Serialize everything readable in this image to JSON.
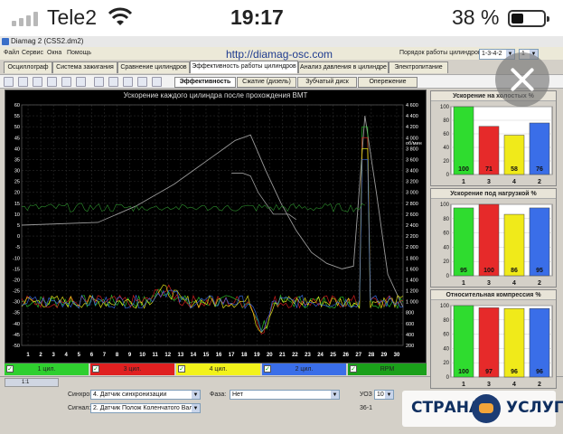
{
  "status": {
    "carrier": "Tele2",
    "time": "19:17",
    "battery_pct": "38 %",
    "battery_level": 0.38
  },
  "window": {
    "title": "Diamag 2 (CSS2.dm2)",
    "menu": [
      "Файл",
      "Сервис",
      "Окна",
      "Помощь"
    ],
    "url": "http://diamag-osc.com",
    "order_label": "Порядок работы цилиндров",
    "order_value": "1-3-4-2",
    "order_small": "1"
  },
  "main_tabs": [
    {
      "label": "Осциллограф",
      "active": false
    },
    {
      "label": "Система зажигания",
      "active": false
    },
    {
      "label": "Сравнение цилиндров",
      "active": false
    },
    {
      "label": "Эффективность работы цилиндров",
      "active": true
    },
    {
      "label": "Анализ давления в цилиндре",
      "active": false
    },
    {
      "label": "Электропитание",
      "active": false
    }
  ],
  "sub_tabs": [
    {
      "label": "Эффективность",
      "active": true
    },
    {
      "label": "Сжатие (дизель)",
      "active": false
    },
    {
      "label": "Зубчатый диск",
      "active": false
    },
    {
      "label": "Опережение",
      "active": false
    }
  ],
  "chart": {
    "title": "Ускорение каждого цилиндра после прохождения ВМТ",
    "left_ticks": [
      "60",
      "55",
      "50",
      "45",
      "40",
      "35",
      "30",
      "25",
      "20",
      "15",
      "10",
      "5",
      "0",
      "-5",
      "-10",
      "-15",
      "-20",
      "-25",
      "-30",
      "-35",
      "-40",
      "-45",
      "-50"
    ],
    "right_ticks": [
      "4 600",
      "4 400",
      "4 200",
      "4 000",
      "3 800",
      "3 600",
      "3 400",
      "3 200",
      "3 000",
      "2 800",
      "2 600",
      "2 400",
      "2 200",
      "2 000",
      "1 800",
      "1 600",
      "1 400",
      "1 200",
      "1 000",
      "800",
      "600",
      "400",
      "200"
    ],
    "x_ticks": [
      "1",
      "2",
      "3",
      "4",
      "5",
      "6",
      "7",
      "8",
      "9",
      "10",
      "11",
      "12",
      "13",
      "14",
      "15",
      "16",
      "17",
      "18",
      "19",
      "20",
      "21",
      "22",
      "23",
      "24",
      "25",
      "26",
      "27",
      "28",
      "29",
      "30"
    ],
    "right_unit": "об/мин"
  },
  "channels": [
    {
      "label": "1 цил.",
      "color": "#2fcf2f"
    },
    {
      "label": "3 цил.",
      "color": "#e02020"
    },
    {
      "label": "4 цил.",
      "color": "#f2f21a"
    },
    {
      "label": "2 цил.",
      "color": "#3a6ee8"
    },
    {
      "label": "RPM",
      "color": "#1aa01a"
    }
  ],
  "bottom": {
    "scale": "1:1",
    "sync_label": "Синхро:",
    "sync_value": "4. Датчик синхронизации",
    "signal_label": "Сигнал:",
    "signal_value": "2. Датчик Полож Коленчатого Вал",
    "phase_label": "Фаза:",
    "phase_value": "Нет",
    "uoz_label": "УОЗ",
    "uoz_value": "10",
    "uoz_sub": "36-1"
  },
  "bar_panels": [
    {
      "title": "Ускорение на холостых %",
      "ticks": [
        "100",
        "80",
        "60",
        "40",
        "20",
        "0"
      ],
      "values": [
        100,
        71,
        58,
        76
      ],
      "labels": [
        "1",
        "3",
        "4",
        "2"
      ]
    },
    {
      "title": "Ускорение под нагрузкой %",
      "ticks": [
        "100",
        "80",
        "60",
        "40",
        "20",
        "0"
      ],
      "values": [
        95,
        100,
        86,
        95
      ],
      "labels": [
        "1",
        "3",
        "4",
        "2"
      ]
    },
    {
      "title": "Относительная компрессия %",
      "ticks": [
        "100",
        "80",
        "60",
        "40",
        "20",
        "0"
      ],
      "values": [
        100,
        97,
        96,
        96
      ],
      "labels": [
        "1",
        "3",
        "4",
        "2"
      ]
    }
  ],
  "bar_colors": [
    "#2fdc2f",
    "#e62a2a",
    "#f0ea1a",
    "#3a6ee8"
  ],
  "watermark": {
    "left": "СТРАНА",
    "right": "УСЛУГ"
  },
  "icons": [
    "signal-icon",
    "wifi-icon",
    "battery-icon",
    "close-icon"
  ]
}
